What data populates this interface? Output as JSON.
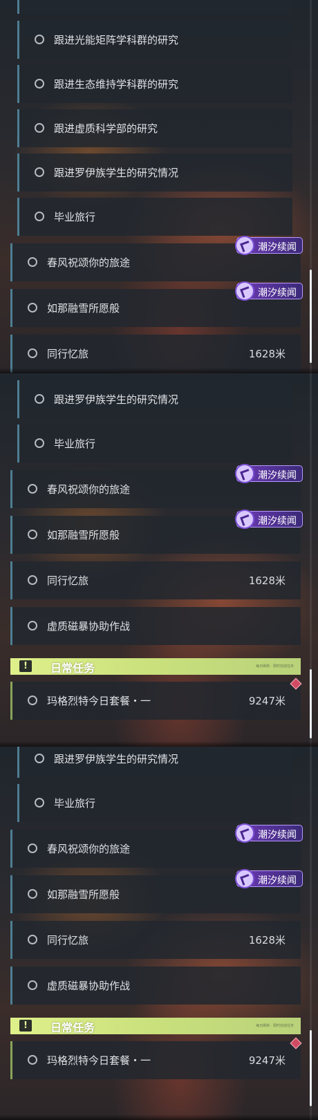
{
  "badge_label": "潮汐续闻",
  "daily_label": "日常任务",
  "alert_glyph": "!",
  "daily_fine_print": "每日刷新 · 限时完成任务",
  "colors": {
    "accent_teal": "#4e7e92",
    "daily_green": "#dff08a",
    "badge_purple": "#6d3ab6",
    "marker_red": "#d14a63"
  },
  "icons": {
    "quest_status": "circle-outline-icon",
    "badge": "tidal-sequel-icon",
    "alert": "exclamation-icon",
    "marker": "diamond-marker-icon"
  },
  "panel1": {
    "items": [
      {
        "title": "跟进光能矩阵学科群的研究",
        "distance": ""
      },
      {
        "title": "跟进生态维持学科群的研究",
        "distance": ""
      },
      {
        "title": "跟进虚质科学部的研究",
        "distance": ""
      },
      {
        "title": "跟进罗伊族学生的研究情况",
        "distance": ""
      },
      {
        "title": "毕业旅行",
        "distance": ""
      },
      {
        "title": "春风祝颂你的旅途",
        "distance": ""
      },
      {
        "title": "如那融雪所愿般",
        "distance": ""
      },
      {
        "title": "同行忆旅",
        "distance": "1628米"
      }
    ]
  },
  "panel2": {
    "items": [
      {
        "title": "跟进罗伊族学生的研究情况",
        "distance": ""
      },
      {
        "title": "毕业旅行",
        "distance": ""
      },
      {
        "title": "春风祝颂你的旅途",
        "distance": ""
      },
      {
        "title": "如那融雪所愿般",
        "distance": ""
      },
      {
        "title": "同行忆旅",
        "distance": "1628米"
      },
      {
        "title": "虚质磁暴协助作战",
        "distance": ""
      },
      {
        "title": "玛格烈特今日套餐・一",
        "distance": "9247米"
      }
    ]
  },
  "panel3": {
    "items": [
      {
        "title": "跟进罗伊族学生的研究情况",
        "distance": ""
      },
      {
        "title": "毕业旅行",
        "distance": ""
      },
      {
        "title": "春风祝颂你的旅途",
        "distance": ""
      },
      {
        "title": "如那融雪所愿般",
        "distance": ""
      },
      {
        "title": "同行忆旅",
        "distance": "1628米"
      },
      {
        "title": "虚质磁暴协助作战",
        "distance": ""
      },
      {
        "title": "玛格烈特今日套餐・一",
        "distance": "9247米"
      }
    ]
  }
}
